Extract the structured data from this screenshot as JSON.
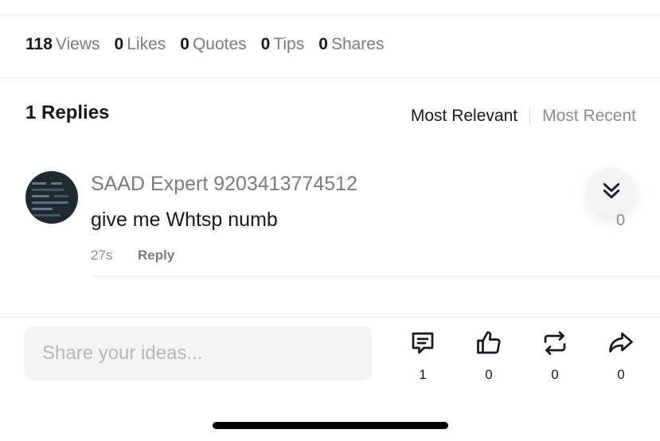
{
  "stats": [
    {
      "value": "118",
      "label": "Views"
    },
    {
      "value": "0",
      "label": "Likes"
    },
    {
      "value": "0",
      "label": "Quotes"
    },
    {
      "value": "0",
      "label": "Tips"
    },
    {
      "value": "0",
      "label": "Shares"
    }
  ],
  "replies": {
    "title": "1 Replies",
    "sort_options": [
      "Most Relevant",
      "Most Recent"
    ],
    "selected_sort": "Most Relevant"
  },
  "comment": {
    "author": "SAAD Expert 9203413774512",
    "text": "give me Whtsp numb",
    "time": "27s",
    "reply_label": "Reply",
    "like_count": "0",
    "collapse_icon": "double-chevron-down-icon"
  },
  "composer": {
    "placeholder": "Share your ideas..."
  },
  "actions": [
    {
      "icon": "comment-icon",
      "count": "1"
    },
    {
      "icon": "thumbs-up-icon",
      "count": "0"
    },
    {
      "icon": "repost-icon",
      "count": "0"
    },
    {
      "icon": "share-icon",
      "count": "0"
    }
  ],
  "colors": {
    "text_primary": "#161823",
    "text_secondary": "#7a7b80",
    "input_bg": "#f4f4f5"
  }
}
